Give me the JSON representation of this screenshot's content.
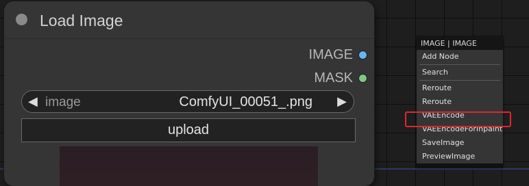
{
  "node": {
    "title": "Load Image",
    "outputs": [
      {
        "label": "IMAGE",
        "color": "#64b5f6"
      },
      {
        "label": "MASK",
        "color": "#81c784"
      }
    ],
    "image_widget": {
      "label": "image",
      "value": "ComfyUI_00051_.png",
      "prev_arrow": "◀",
      "next_arrow": "▶"
    },
    "upload_label": "upload"
  },
  "context_menu": {
    "title": "IMAGE | IMAGE",
    "items": [
      {
        "label": "Add Node"
      },
      {
        "label": "Search"
      },
      {
        "label": "Reroute"
      },
      {
        "label": "Reroute"
      },
      {
        "label": "VAEEncode",
        "highlighted": true
      },
      {
        "label": "VAEEncodeForInpaint"
      },
      {
        "label": "SaveImage"
      },
      {
        "label": "PreviewImage"
      }
    ]
  },
  "colors": {
    "highlight_outline": "#e3262b",
    "link_wire": "#2b3a63"
  }
}
